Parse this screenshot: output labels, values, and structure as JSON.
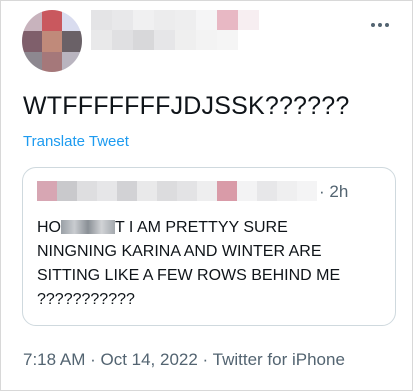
{
  "tweet": {
    "text": "WTFFFFFFFJDJSSK??????",
    "translate_label": "Translate Tweet",
    "timestamp": "7:18 AM · Oct 14, 2022 · Twitter for iPhone"
  },
  "quoted": {
    "time": "· 2h",
    "line1_prefix": "HO",
    "line1_suffix": "T I AM PRETTYY  SURE",
    "line2": "NINGNING KARINA AND WINTER ARE",
    "line3": "SITTING LIKE A FEW ROWS BEHIND ME",
    "line4": "???????????"
  },
  "colors": {
    "link": "#1d9bf0",
    "secondary_text": "#536471",
    "border": "#cfd9de"
  },
  "icons": {
    "more": "more-horizontal-icon"
  }
}
